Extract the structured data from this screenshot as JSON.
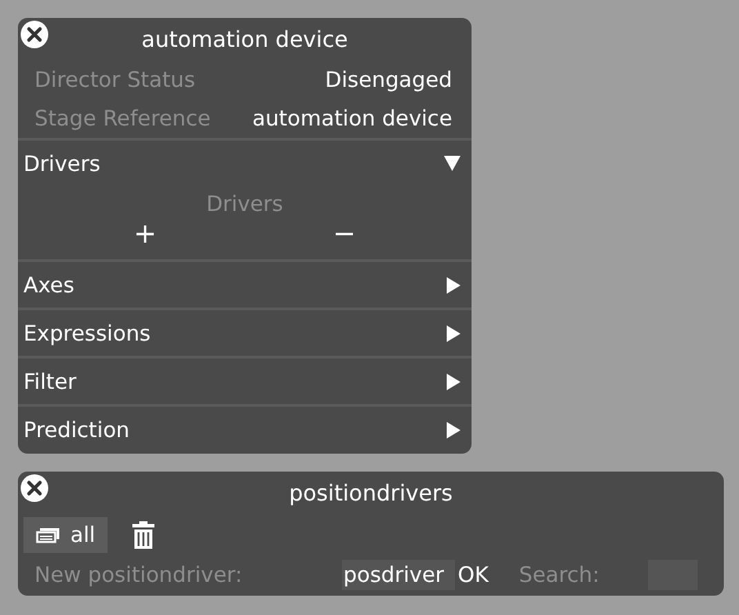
{
  "device_window": {
    "title": "automation device",
    "properties": [
      {
        "label": "Director Status",
        "value": "Disengaged"
      },
      {
        "label": "Stage Reference",
        "value": "automation device"
      }
    ],
    "sections": [
      {
        "label": "Drivers",
        "expanded": true,
        "list_title": "Drivers",
        "add": "+",
        "remove": "−"
      },
      {
        "label": "Axes",
        "expanded": false
      },
      {
        "label": "Expressions",
        "expanded": false
      },
      {
        "label": "Filter",
        "expanded": false
      },
      {
        "label": "Prediction",
        "expanded": false
      }
    ]
  },
  "list_window": {
    "title": "positiondrivers",
    "filter_button": "all",
    "new_label": "New positiondriver:",
    "new_value": "posdriver",
    "ok": "OK",
    "search_label": "Search:"
  }
}
